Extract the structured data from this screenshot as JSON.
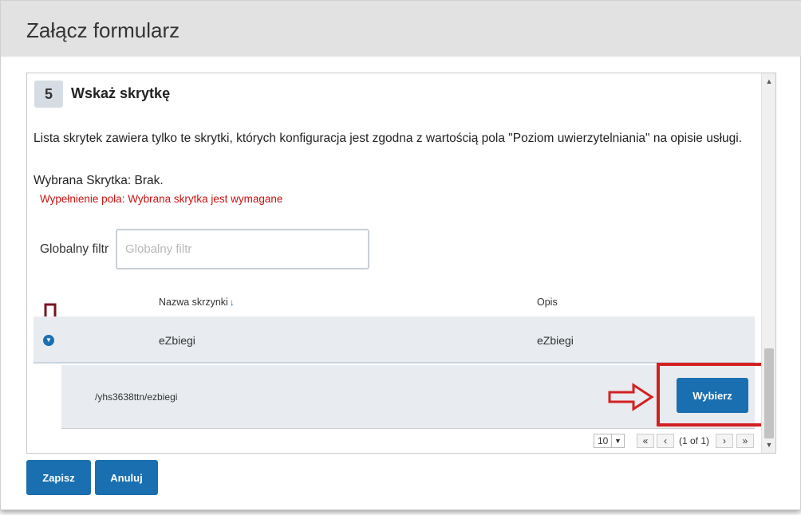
{
  "dialog": {
    "title": "Załącz formularz"
  },
  "step": {
    "number": "5",
    "title": "Wskaż skrytkę",
    "description": "Lista skrytek zawiera tylko te skrytki, których konfiguracja jest zgodna z wartością pola \"Poziom uwierzytelniania\" na opisie usługi.",
    "selected": "Wybrana Skrytka: Brak.",
    "validation_error": "Wypełnienie pola: Wybrana skrytka jest wymagane"
  },
  "filter": {
    "label": "Globalny filtr",
    "placeholder": "Globalny filtr",
    "value": ""
  },
  "table": {
    "columns": [
      {
        "label": "Nazwa skrzynki",
        "sorted": "desc"
      },
      {
        "label": "Opis"
      }
    ],
    "rows": [
      {
        "name": "eZbiegi",
        "description": "eZbiegi",
        "expanded": true,
        "detail_path": "/yhs3638ttn/ezbiegi",
        "select_label": "Wybierz"
      }
    ]
  },
  "pagination": {
    "page_size": "10",
    "page_info": "(1 of 1)",
    "first": "«",
    "prev": "‹",
    "next": "›",
    "last": "»"
  },
  "footer": {
    "save_label": "Zapisz",
    "cancel_label": "Anuluj"
  },
  "icons": {
    "expand": "chevron-down-circle-icon",
    "sort": "sort-down-icon",
    "annotation_down": "arrow-down-annotation",
    "annotation_right": "arrow-right-annotation"
  },
  "colors": {
    "primary": "#1a6fb0",
    "error": "#cc1111",
    "annotation_red": "#d42020",
    "annotation_dark": "#7a1420",
    "header_bg": "#e2e2e2",
    "row_bg": "#e8ebef"
  }
}
